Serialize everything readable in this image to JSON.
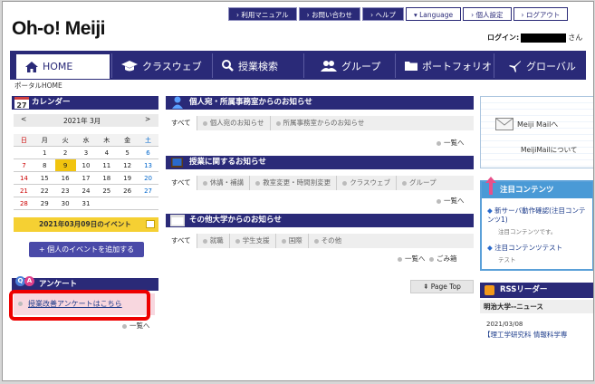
{
  "header": {
    "logo": "Oh-o! Meiji",
    "login_label": "ログイン:",
    "login_suffix": "さん",
    "links": [
      {
        "label": "利用マニュアル",
        "style": "dark"
      },
      {
        "label": "お問い合わせ",
        "style": "dark"
      },
      {
        "label": "ヘルプ",
        "style": "dark"
      },
      {
        "label": "▾ Language",
        "style": "light"
      },
      {
        "label": "個人設定",
        "style": "light"
      },
      {
        "label": "ログアウト",
        "style": "light"
      }
    ]
  },
  "nav": {
    "tabs": [
      "HOME",
      "クラスウェブ",
      "授業検索",
      "グループ",
      "ポートフォリオ",
      "グローバル"
    ]
  },
  "breadcrumb": "ポータルHOME",
  "calendar": {
    "title": "カレンダー",
    "day_badge": "27",
    "month_label": "2021年 3月",
    "prev": "<",
    "next": ">",
    "weekdays": [
      "日",
      "月",
      "火",
      "水",
      "木",
      "金",
      "土"
    ],
    "weeks": [
      [
        "",
        "1",
        "2",
        "3",
        "4",
        "5",
        "6"
      ],
      [
        "7",
        "8",
        "9",
        "10",
        "11",
        "12",
        "13"
      ],
      [
        "14",
        "15",
        "16",
        "17",
        "18",
        "19",
        "20"
      ],
      [
        "21",
        "22",
        "23",
        "24",
        "25",
        "26",
        "27"
      ],
      [
        "28",
        "29",
        "30",
        "31",
        "",
        "",
        ""
      ]
    ],
    "today": "9",
    "event_label": "2021年03月09日のイベント",
    "add_event": "+ 個人のイベントを追加する"
  },
  "survey": {
    "title": "アンケート",
    "link": "授業改善アンケートはこちら",
    "more": "一覧へ"
  },
  "notices": [
    {
      "title": "個人宛・所属事務室からのお知らせ",
      "tabs": [
        "すべて",
        "個人宛のお知らせ",
        "所属事務室からのお知らせ"
      ],
      "more": "一覧へ",
      "extra": ""
    },
    {
      "title": "授業に関するお知らせ",
      "tabs": [
        "すべて",
        "休講・補講",
        "教室変更・時間割変更",
        "クラスウェブ",
        "グループ"
      ],
      "more": "一覧へ",
      "extra": ""
    },
    {
      "title": "その他大学からのお知らせ",
      "tabs": [
        "すべて",
        "就職",
        "学生支援",
        "国際",
        "その他"
      ],
      "more": "一覧へ",
      "extra": "ごみ箱"
    }
  ],
  "page_top": "Page Top",
  "meiji_mail": {
    "label": "Meiji Mailへ",
    "about": "MeijiMailについて"
  },
  "featured": {
    "title": "注目コンテンツ",
    "items": [
      {
        "title": "新サーバ動作確認(注目コンテンツ1)",
        "desc": "注目コンテンツです。"
      },
      {
        "title": "注目コンテンツテスト",
        "desc": "テスト"
      }
    ]
  },
  "rss": {
    "title": "RSSリーダー",
    "source": "明治大学--ニュース",
    "date": "2021/03/08",
    "item": "【理工学研究科 情報科学専"
  },
  "colors": {
    "navy": "#2a2a78",
    "accent_yellow": "#f5d033",
    "highlight_red": "#ee0000"
  }
}
